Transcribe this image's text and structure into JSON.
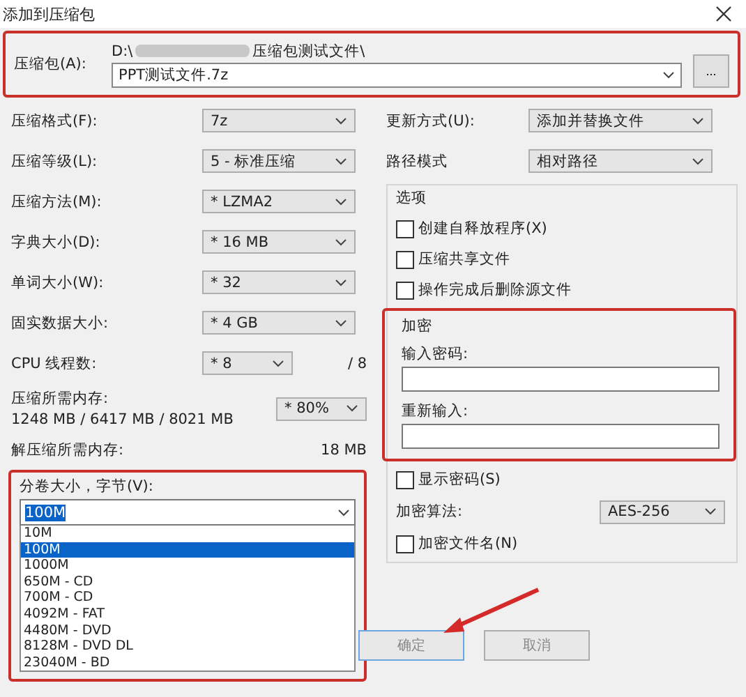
{
  "window": {
    "title": "添加到压缩包"
  },
  "archive": {
    "label": "压缩包(A):",
    "path_start": "D:\\",
    "path_end": "压缩包测试文件\\",
    "filename": "PPT测试文件.7z",
    "browse": "..."
  },
  "left_rows": [
    {
      "kind": "combo",
      "label": "压缩格式(F):",
      "value": "7z"
    },
    {
      "kind": "combo",
      "label": "压缩等级(L):",
      "value": "5 - 标准压缩"
    },
    {
      "kind": "combo",
      "label": "压缩方法(M):",
      "value": "* LZMA2"
    },
    {
      "kind": "combo",
      "label": "字典大小(D):",
      "value": "* 16 MB"
    },
    {
      "kind": "combo",
      "label": "单词大小(W):",
      "value": "* 32"
    },
    {
      "kind": "combo",
      "label": "固实数据大小:",
      "value": "* 4 GB"
    },
    {
      "kind": "cpu",
      "label": "CPU 线程数:",
      "value": "* 8",
      "suffix": "/ 8"
    },
    {
      "kind": "memory",
      "label": "压缩所需内存:",
      "detail": "1248 MB / 6417 MB / 8021 MB",
      "value": "* 80%"
    },
    {
      "kind": "info",
      "label": "解压缩所需内存:",
      "value": "18 MB"
    }
  ],
  "volume": {
    "label": "分卷大小，字节(V):",
    "value": "100M",
    "items": [
      {
        "label": "10M",
        "selected": false
      },
      {
        "label": "100M",
        "selected": true
      },
      {
        "label": "1000M",
        "selected": false
      },
      {
        "label": "650M - CD",
        "selected": false
      },
      {
        "label": "700M - CD",
        "selected": false
      },
      {
        "label": "4092M - FAT",
        "selected": false
      },
      {
        "label": "4480M - DVD",
        "selected": false
      },
      {
        "label": "8128M - DVD DL",
        "selected": false
      },
      {
        "label": "23040M - BD",
        "selected": false
      }
    ]
  },
  "right_rows": [
    {
      "label": "更新方式(U):",
      "value": "添加并替换文件"
    },
    {
      "label": "路径模式",
      "value": "相对路径"
    }
  ],
  "options": {
    "title": "选项",
    "items": [
      {
        "label": "创建自释放程序(X)",
        "checked": false
      },
      {
        "label": "压缩共享文件",
        "checked": false
      },
      {
        "label": "操作完成后删除源文件",
        "checked": false
      }
    ]
  },
  "encryption": {
    "title": "加密",
    "fields": [
      {
        "label": "输入密码:"
      },
      {
        "label": "重新输入:"
      }
    ],
    "show_password": {
      "label": "显示密码(S)",
      "checked": false
    },
    "algorithm": {
      "label": "加密算法:",
      "value": "AES-256"
    },
    "encrypt_names": {
      "label": "加密文件名(N)",
      "checked": false
    }
  },
  "buttons": [
    {
      "label": "确定",
      "default": true
    },
    {
      "label": "取消",
      "default": false
    }
  ]
}
